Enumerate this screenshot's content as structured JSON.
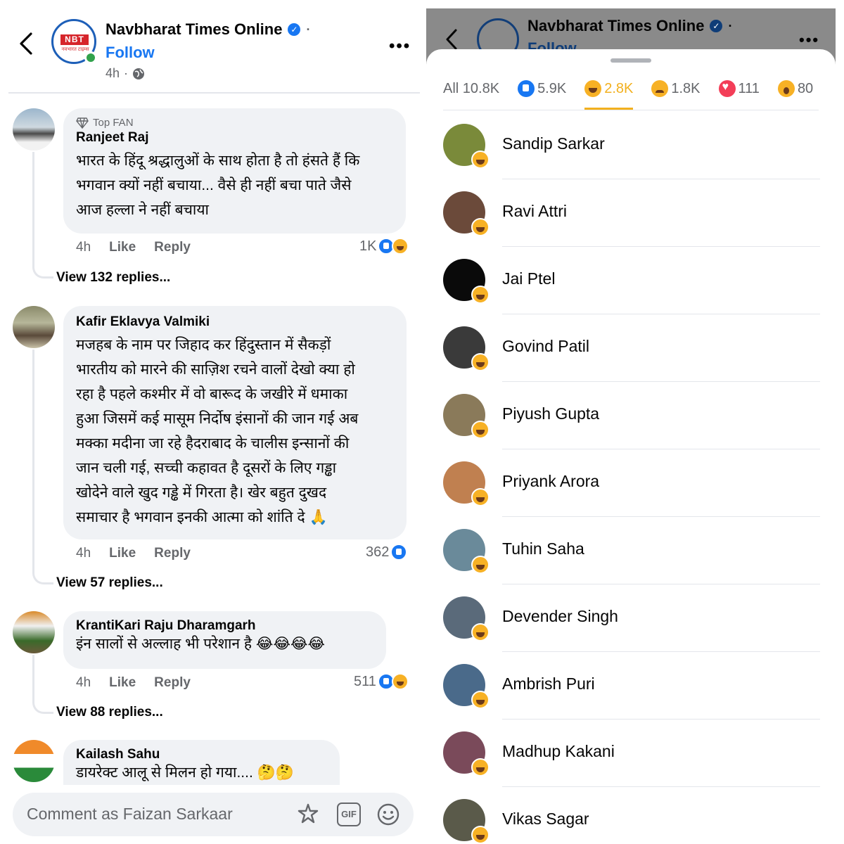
{
  "left": {
    "page_name": "Navbharat Times Online",
    "follow": "Follow",
    "time": "4h",
    "logo_text": "NBT",
    "logo_sub": "नवभारत टाइम्स",
    "comments": [
      {
        "badge": "Top FAN",
        "author": "Ranjeet Raj",
        "lines": [
          "भारत के हिंदू श्रद्धालुओं के साथ होता है तो हंसते हैं कि",
          "भगवान क्यों नहीं बचाया... वैसे ही नहीं बचा पाते जैसे",
          "आज हल्ला ने नहीं बचाया"
        ],
        "time": "4h",
        "like": "Like",
        "reply": "Reply",
        "reaction_count": "1K",
        "view_replies": "View 132 replies..."
      },
      {
        "author": "Kafir Eklavya Valmiki",
        "lines": [
          "मजहब के नाम पर जिहाद कर हिंदुस्तान में सैकड़ों",
          "भारतीय को मारने की साज़िश रचने वालों देखो क्या हो",
          "रहा है पहले कश्मीर में वो बारूद के जखीरे में धमाका",
          "हुआ जिसमें कई मासूम निर्दोष इंसानों की जान गई अब",
          "मक्का मदीना जा रहे हैदराबाद के चालीस इन्सानों की",
          "जान चली गई, सच्ची कहावत है दूसरों के लिए गड्ढा",
          "खोदेने वाले खुद गड्ढे में गिरता है। खेर बहुत दुखद",
          "समाचार है भगवान इनकी आत्मा को शांति दे 🙏"
        ],
        "time": "4h",
        "like": "Like",
        "reply": "Reply",
        "reaction_count": "362",
        "view_replies": "View 57 replies..."
      },
      {
        "author": "KrantiKari Raju Dharamgarh",
        "lines": [
          "इंन सालों से अल्लाह भी परेशान है 😂😂😂😂"
        ],
        "time": "4h",
        "like": "Like",
        "reply": "Reply",
        "reaction_count": "511",
        "view_replies": "View 88 replies..."
      },
      {
        "author": "Kailash Sahu",
        "lines": [
          "डायरेक्ट आलू से मिलन हो गया.... 🤔🤔"
        ]
      }
    ],
    "composer_placeholder": "Comment as Faizan Sarkaar",
    "composer_icons": [
      "sticker-icon",
      "gif-icon",
      "emoji-icon"
    ],
    "gif_label": "GIF"
  },
  "right": {
    "page_name": "Navbharat Times Online",
    "follow": "Follow",
    "tabs": [
      {
        "label": "All 10.8K",
        "icon": ""
      },
      {
        "label": "5.9K",
        "icon": "like"
      },
      {
        "label": "2.8K",
        "icon": "haha",
        "active": true
      },
      {
        "label": "1.8K",
        "icon": "sad"
      },
      {
        "label": "111",
        "icon": "love"
      },
      {
        "label": "80",
        "icon": "wow"
      }
    ],
    "people": [
      {
        "name": "Sandip Sarkar",
        "avatar_color": "#7a8a3a"
      },
      {
        "name": "Ravi Attri",
        "avatar_color": "#6b4a3a"
      },
      {
        "name": "Jai Ptel",
        "avatar_color": "#0a0a0a"
      },
      {
        "name": "Govind Patil",
        "avatar_color": "#3a3a3a"
      },
      {
        "name": "Piyush Gupta",
        "avatar_color": "#8a7a5a"
      },
      {
        "name": "Priyank Arora",
        "avatar_color": "#c08050"
      },
      {
        "name": "Tuhin Saha",
        "avatar_color": "#6a8a9a"
      },
      {
        "name": "Devender Singh",
        "avatar_color": "#5a6a7a"
      },
      {
        "name": "Ambrish Puri",
        "avatar_color": "#4a6a8a"
      },
      {
        "name": "Madhup Kakani",
        "avatar_color": "#7a4a5a"
      },
      {
        "name": "Vikas Sagar",
        "avatar_color": "#5a5a4a"
      }
    ]
  },
  "colors": {
    "accent": "#1877f2",
    "haha": "#f7b125",
    "muted": "#65676b",
    "bubble": "#f0f2f5"
  }
}
